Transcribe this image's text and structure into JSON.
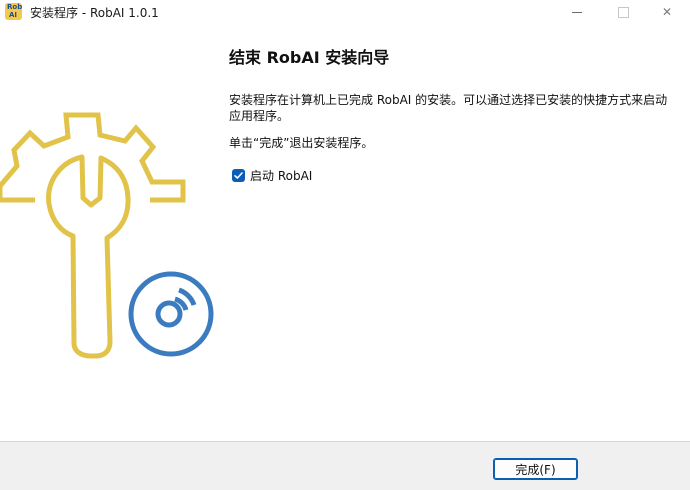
{
  "window": {
    "title": "安装程序 - RobAI 1.0.1",
    "app_icon_text_top": "Rob",
    "app_icon_text_bottom": "AI",
    "controls": {
      "minimize": "minimize",
      "maximize": "maximize",
      "close": "✕"
    }
  },
  "main": {
    "heading": "结束 RobAI 安装向导",
    "paragraph1": "安装程序在计算机上已完成 RobAI 的安装。可以通过选择已安装的快捷方式来启动应用程序。",
    "paragraph2": "单击“完成”退出安装程序。",
    "launch_checkbox": {
      "label": "启动 RobAI",
      "checked": true
    }
  },
  "footer": {
    "finish_button": "完成(F)"
  },
  "colors": {
    "gear_yellow": "#e1c34a",
    "disc_blue": "#3b7bbf",
    "accent": "#0a5fb4"
  },
  "icons": {
    "sidebar": [
      "gear-icon",
      "wrench-icon",
      "disc-icon"
    ]
  }
}
